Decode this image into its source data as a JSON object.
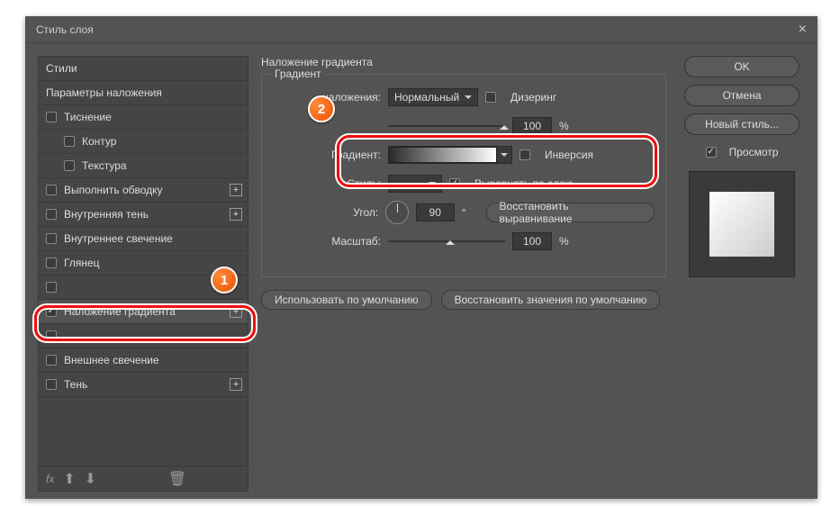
{
  "window": {
    "title": "Стиль слоя"
  },
  "styles": {
    "header": "Стили",
    "blending": "Параметры наложения",
    "items": [
      {
        "label": "Тиснение",
        "checked": false,
        "plus": false,
        "sub": false
      },
      {
        "label": "Контур",
        "checked": false,
        "plus": false,
        "sub": true
      },
      {
        "label": "Текстура",
        "checked": false,
        "plus": false,
        "sub": true
      },
      {
        "label": "Выполнить обводку",
        "checked": false,
        "plus": true,
        "sub": false
      },
      {
        "label": "Внутренняя тень",
        "checked": false,
        "plus": true,
        "sub": false
      },
      {
        "label": "Внутреннее свечение",
        "checked": false,
        "plus": false,
        "sub": false
      },
      {
        "label": "Глянец",
        "checked": false,
        "plus": false,
        "sub": false
      },
      {
        "label": "",
        "checked": false,
        "plus": false,
        "sub": false
      },
      {
        "label": "Наложение градиента",
        "checked": true,
        "plus": true,
        "sub": false,
        "selected": true
      },
      {
        "label": "",
        "checked": false,
        "plus": false,
        "sub": false
      },
      {
        "label": "Внешнее свечение",
        "checked": false,
        "plus": false,
        "sub": false
      },
      {
        "label": "Тень",
        "checked": false,
        "plus": true,
        "sub": false
      }
    ],
    "footer": {
      "fx": "fx",
      "up": "⬆",
      "down": "⬇",
      "trash": "🗑"
    }
  },
  "mid": {
    "panel_title": "Наложение градиента",
    "legend": "Градиент",
    "rows": {
      "blendmode": {
        "label": "наложения:",
        "value": "Нормальный",
        "dither": "Дизеринг"
      },
      "opacity": {
        "label": "",
        "value": "100",
        "unit": "%"
      },
      "gradient": {
        "label": "Градиент:",
        "reverse": "Инверсия"
      },
      "style": {
        "label": "Стиль:",
        "value": "",
        "align": "Выровнять по слою"
      },
      "angle": {
        "label": "Угол:",
        "value": "90",
        "unit": "°",
        "reset": "Восстановить выравнивание"
      },
      "scale": {
        "label": "Масштаб:",
        "value": "100",
        "unit": "%"
      }
    },
    "defaults": {
      "make": "Использовать по умолчанию",
      "reset": "Восстановить значения по умолчанию"
    }
  },
  "right": {
    "ok": "OK",
    "cancel": "Отмена",
    "newstyle": "Новый стиль...",
    "preview": "Просмотр"
  },
  "callouts": {
    "one": "1",
    "two": "2"
  }
}
